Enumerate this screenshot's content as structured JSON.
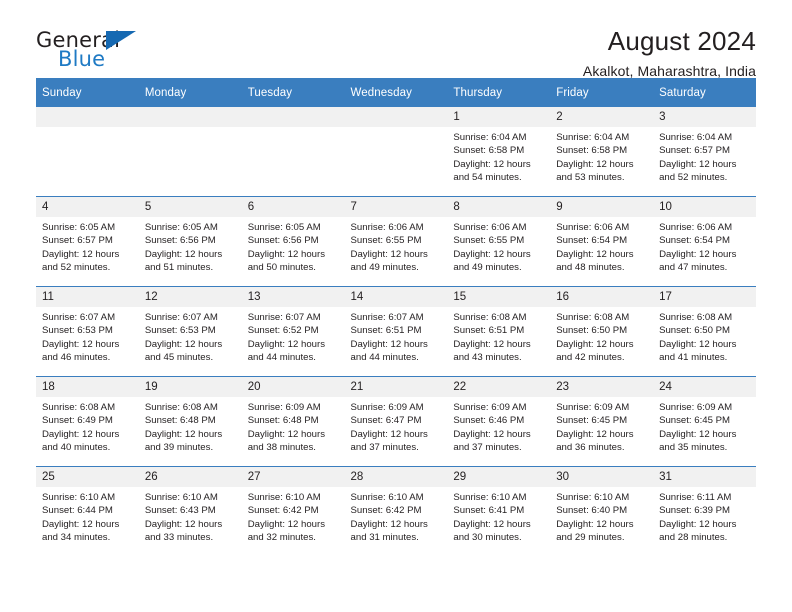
{
  "brand": {
    "name_part1": "General",
    "name_part2": "Blue",
    "triangle_color": "#1669b2",
    "blue": "#1f7ac4"
  },
  "header": {
    "title": "August 2024",
    "location": "Akalkot, Maharashtra, India"
  },
  "theme": {
    "header_bg": "#3a7ebf",
    "daynum_bg": "#f1f1f1",
    "text": "#231f20"
  },
  "weekdays": [
    "Sunday",
    "Monday",
    "Tuesday",
    "Wednesday",
    "Thursday",
    "Friday",
    "Saturday"
  ],
  "weeks": [
    [
      {
        "day": "",
        "sunrise": "",
        "sunset": "",
        "daylight1": "",
        "daylight2": ""
      },
      {
        "day": "",
        "sunrise": "",
        "sunset": "",
        "daylight1": "",
        "daylight2": ""
      },
      {
        "day": "",
        "sunrise": "",
        "sunset": "",
        "daylight1": "",
        "daylight2": ""
      },
      {
        "day": "",
        "sunrise": "",
        "sunset": "",
        "daylight1": "",
        "daylight2": ""
      },
      {
        "day": "1",
        "sunrise": "Sunrise: 6:04 AM",
        "sunset": "Sunset: 6:58 PM",
        "daylight1": "Daylight: 12 hours",
        "daylight2": "and 54 minutes."
      },
      {
        "day": "2",
        "sunrise": "Sunrise: 6:04 AM",
        "sunset": "Sunset: 6:58 PM",
        "daylight1": "Daylight: 12 hours",
        "daylight2": "and 53 minutes."
      },
      {
        "day": "3",
        "sunrise": "Sunrise: 6:04 AM",
        "sunset": "Sunset: 6:57 PM",
        "daylight1": "Daylight: 12 hours",
        "daylight2": "and 52 minutes."
      }
    ],
    [
      {
        "day": "4",
        "sunrise": "Sunrise: 6:05 AM",
        "sunset": "Sunset: 6:57 PM",
        "daylight1": "Daylight: 12 hours",
        "daylight2": "and 52 minutes."
      },
      {
        "day": "5",
        "sunrise": "Sunrise: 6:05 AM",
        "sunset": "Sunset: 6:56 PM",
        "daylight1": "Daylight: 12 hours",
        "daylight2": "and 51 minutes."
      },
      {
        "day": "6",
        "sunrise": "Sunrise: 6:05 AM",
        "sunset": "Sunset: 6:56 PM",
        "daylight1": "Daylight: 12 hours",
        "daylight2": "and 50 minutes."
      },
      {
        "day": "7",
        "sunrise": "Sunrise: 6:06 AM",
        "sunset": "Sunset: 6:55 PM",
        "daylight1": "Daylight: 12 hours",
        "daylight2": "and 49 minutes."
      },
      {
        "day": "8",
        "sunrise": "Sunrise: 6:06 AM",
        "sunset": "Sunset: 6:55 PM",
        "daylight1": "Daylight: 12 hours",
        "daylight2": "and 49 minutes."
      },
      {
        "day": "9",
        "sunrise": "Sunrise: 6:06 AM",
        "sunset": "Sunset: 6:54 PM",
        "daylight1": "Daylight: 12 hours",
        "daylight2": "and 48 minutes."
      },
      {
        "day": "10",
        "sunrise": "Sunrise: 6:06 AM",
        "sunset": "Sunset: 6:54 PM",
        "daylight1": "Daylight: 12 hours",
        "daylight2": "and 47 minutes."
      }
    ],
    [
      {
        "day": "11",
        "sunrise": "Sunrise: 6:07 AM",
        "sunset": "Sunset: 6:53 PM",
        "daylight1": "Daylight: 12 hours",
        "daylight2": "and 46 minutes."
      },
      {
        "day": "12",
        "sunrise": "Sunrise: 6:07 AM",
        "sunset": "Sunset: 6:53 PM",
        "daylight1": "Daylight: 12 hours",
        "daylight2": "and 45 minutes."
      },
      {
        "day": "13",
        "sunrise": "Sunrise: 6:07 AM",
        "sunset": "Sunset: 6:52 PM",
        "daylight1": "Daylight: 12 hours",
        "daylight2": "and 44 minutes."
      },
      {
        "day": "14",
        "sunrise": "Sunrise: 6:07 AM",
        "sunset": "Sunset: 6:51 PM",
        "daylight1": "Daylight: 12 hours",
        "daylight2": "and 44 minutes."
      },
      {
        "day": "15",
        "sunrise": "Sunrise: 6:08 AM",
        "sunset": "Sunset: 6:51 PM",
        "daylight1": "Daylight: 12 hours",
        "daylight2": "and 43 minutes."
      },
      {
        "day": "16",
        "sunrise": "Sunrise: 6:08 AM",
        "sunset": "Sunset: 6:50 PM",
        "daylight1": "Daylight: 12 hours",
        "daylight2": "and 42 minutes."
      },
      {
        "day": "17",
        "sunrise": "Sunrise: 6:08 AM",
        "sunset": "Sunset: 6:50 PM",
        "daylight1": "Daylight: 12 hours",
        "daylight2": "and 41 minutes."
      }
    ],
    [
      {
        "day": "18",
        "sunrise": "Sunrise: 6:08 AM",
        "sunset": "Sunset: 6:49 PM",
        "daylight1": "Daylight: 12 hours",
        "daylight2": "and 40 minutes."
      },
      {
        "day": "19",
        "sunrise": "Sunrise: 6:08 AM",
        "sunset": "Sunset: 6:48 PM",
        "daylight1": "Daylight: 12 hours",
        "daylight2": "and 39 minutes."
      },
      {
        "day": "20",
        "sunrise": "Sunrise: 6:09 AM",
        "sunset": "Sunset: 6:48 PM",
        "daylight1": "Daylight: 12 hours",
        "daylight2": "and 38 minutes."
      },
      {
        "day": "21",
        "sunrise": "Sunrise: 6:09 AM",
        "sunset": "Sunset: 6:47 PM",
        "daylight1": "Daylight: 12 hours",
        "daylight2": "and 37 minutes."
      },
      {
        "day": "22",
        "sunrise": "Sunrise: 6:09 AM",
        "sunset": "Sunset: 6:46 PM",
        "daylight1": "Daylight: 12 hours",
        "daylight2": "and 37 minutes."
      },
      {
        "day": "23",
        "sunrise": "Sunrise: 6:09 AM",
        "sunset": "Sunset: 6:45 PM",
        "daylight1": "Daylight: 12 hours",
        "daylight2": "and 36 minutes."
      },
      {
        "day": "24",
        "sunrise": "Sunrise: 6:09 AM",
        "sunset": "Sunset: 6:45 PM",
        "daylight1": "Daylight: 12 hours",
        "daylight2": "and 35 minutes."
      }
    ],
    [
      {
        "day": "25",
        "sunrise": "Sunrise: 6:10 AM",
        "sunset": "Sunset: 6:44 PM",
        "daylight1": "Daylight: 12 hours",
        "daylight2": "and 34 minutes."
      },
      {
        "day": "26",
        "sunrise": "Sunrise: 6:10 AM",
        "sunset": "Sunset: 6:43 PM",
        "daylight1": "Daylight: 12 hours",
        "daylight2": "and 33 minutes."
      },
      {
        "day": "27",
        "sunrise": "Sunrise: 6:10 AM",
        "sunset": "Sunset: 6:42 PM",
        "daylight1": "Daylight: 12 hours",
        "daylight2": "and 32 minutes."
      },
      {
        "day": "28",
        "sunrise": "Sunrise: 6:10 AM",
        "sunset": "Sunset: 6:42 PM",
        "daylight1": "Daylight: 12 hours",
        "daylight2": "and 31 minutes."
      },
      {
        "day": "29",
        "sunrise": "Sunrise: 6:10 AM",
        "sunset": "Sunset: 6:41 PM",
        "daylight1": "Daylight: 12 hours",
        "daylight2": "and 30 minutes."
      },
      {
        "day": "30",
        "sunrise": "Sunrise: 6:10 AM",
        "sunset": "Sunset: 6:40 PM",
        "daylight1": "Daylight: 12 hours",
        "daylight2": "and 29 minutes."
      },
      {
        "day": "31",
        "sunrise": "Sunrise: 6:11 AM",
        "sunset": "Sunset: 6:39 PM",
        "daylight1": "Daylight: 12 hours",
        "daylight2": "and 28 minutes."
      }
    ]
  ]
}
